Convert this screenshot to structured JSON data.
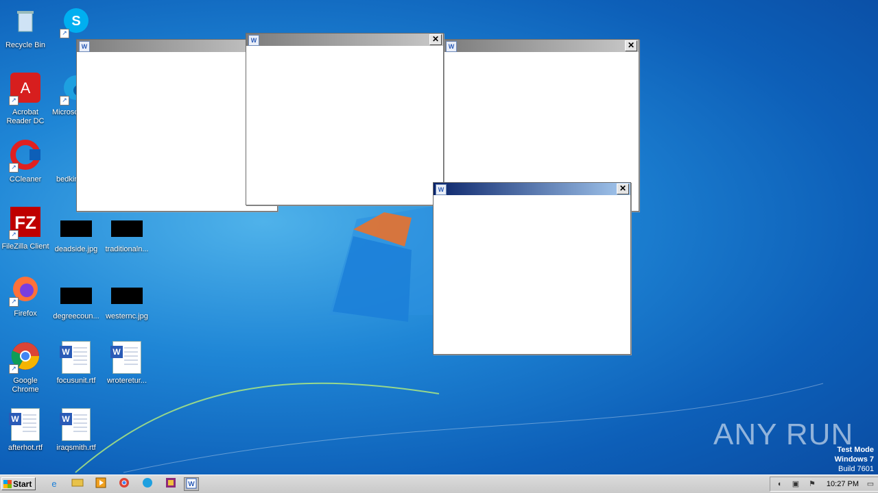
{
  "desktop_icons": [
    {
      "label": "Recycle Bin"
    },
    {
      "label": "Sky"
    },
    {
      "label": "Acrobat Reader DC"
    },
    {
      "label": "Microso"
    },
    {
      "label": "CCleaner"
    },
    {
      "label": "bedkin"
    },
    {
      "label": "FileZilla Client"
    },
    {
      "label": "deadside.jpg"
    },
    {
      "label": "traditionaln..."
    },
    {
      "label": "Firefox"
    },
    {
      "label": "degreecoun..."
    },
    {
      "label": "westernc.jpg"
    },
    {
      "label": "Google Chrome"
    },
    {
      "label": "focusunit.rtf"
    },
    {
      "label": "wroteretur..."
    },
    {
      "label": "afterhot.rtf"
    },
    {
      "label": "iraqsmith.rtf"
    }
  ],
  "windows": {
    "close_glyph": "✕",
    "icon_glyph": "W"
  },
  "taskbar": {
    "start_label": "Start",
    "clock": "10:27 PM"
  },
  "watermark": {
    "line1": "Test Mode",
    "line2": "Windows 7",
    "line3": "Build 7601",
    "brand": "ANY RUN"
  }
}
